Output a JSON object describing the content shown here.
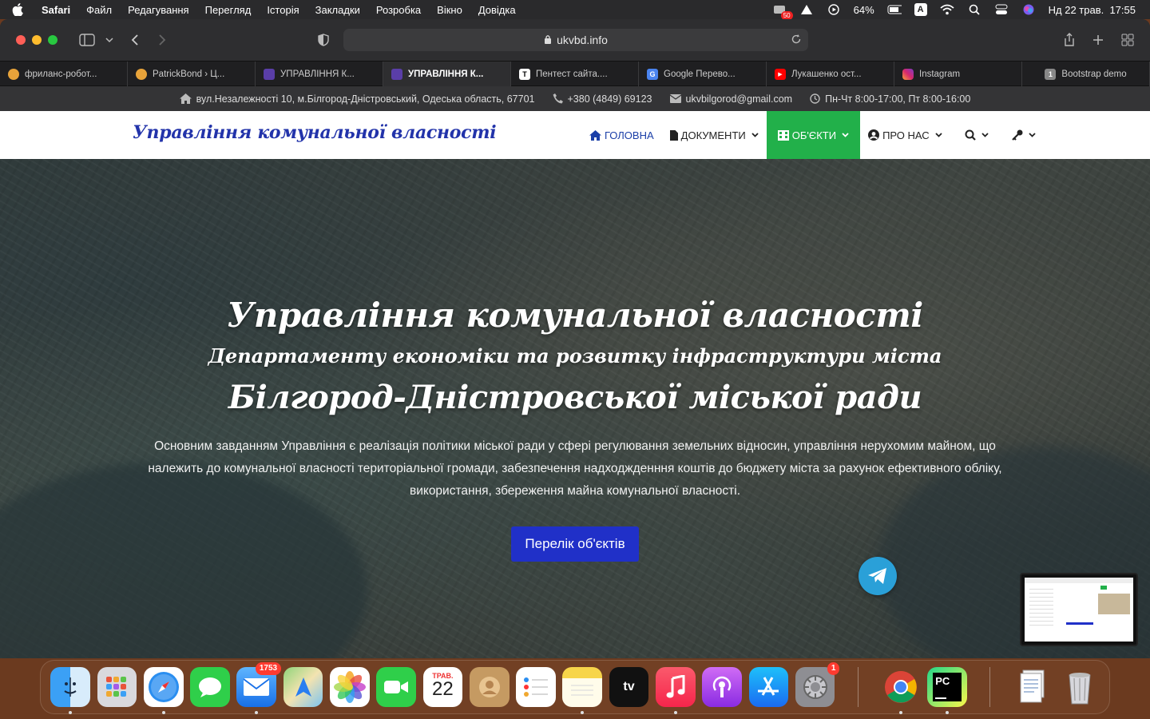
{
  "menubar": {
    "app": "Safari",
    "items": [
      "Файл",
      "Редагування",
      "Перегляд",
      "Історія",
      "Закладки",
      "Розробка",
      "Вікно",
      "Довідка"
    ],
    "battery": "64%",
    "input_source": "A",
    "datetime": "Нд 22 трав.  17:55",
    "badge": "50"
  },
  "browser": {
    "url": "ukvbd.info",
    "tabs": [
      {
        "title": "фриланс-робот...",
        "color": "#e8a33a",
        "fav": ""
      },
      {
        "title": "PatrickBond › Ц...",
        "color": "#e8a33a",
        "fav": ""
      },
      {
        "title": "УПРАВЛІННЯ К...",
        "color": "#5a3ea8",
        "fav": ""
      },
      {
        "title": "УПРАВЛІННЯ К...",
        "color": "#5a3ea8",
        "fav": ""
      },
      {
        "title": "Пентест сайта....",
        "color": "#ffffff",
        "fav": "T"
      },
      {
        "title": "Google Перево...",
        "color": "#4a84f0",
        "fav": "G"
      },
      {
        "title": "Лукашенко ост...",
        "color": "#ff0000",
        "fav": "▶"
      },
      {
        "title": "Instagram",
        "color": "#d6286d",
        "fav": ""
      },
      {
        "title": "Bootstrap demo",
        "color": "#888888",
        "fav": "1"
      }
    ],
    "active_tab": 3
  },
  "site": {
    "topinfo": {
      "address": "вул.Незалежності 10, м.Білгород-Дністровський, Одеська область, 67701",
      "phone": "+380 (4849) 69123",
      "email": "ukvbilgorod@gmail.com",
      "hours": "Пн-Чт 8:00-17:00, Пт 8:00-16:00"
    },
    "brand": "Управління комунальної власності",
    "nav": {
      "home": "ГОЛОВНА",
      "documents": "ДОКУМЕНТИ",
      "objects": "ОБ'ЄКТИ",
      "about": "ПРО НАС"
    },
    "hero": {
      "line1": "Управління комунальної власності",
      "line2": "Департаменту економіки та розвитку інфраструктури міста",
      "line3": "Білгород-Дністровської міської ради",
      "description": "Основним завданням Управління є реалізація політики міської ради у сфері регулювання земельних відносин, управління нерухомим майном, що належить до комунальної власності територіальної громади, забезпечення надходжденння коштів до бюджету міста за рахунок ефективного обліку, використання, збереження майна комунальної власності.",
      "cta": "Перелік об'єктів"
    }
  },
  "dock": {
    "mail_badge": "1753",
    "calendar_month": "ТРАВ.",
    "calendar_day": "22",
    "settings_badge": "1",
    "appletv_label": "tv",
    "pycharm_label": "PC"
  }
}
